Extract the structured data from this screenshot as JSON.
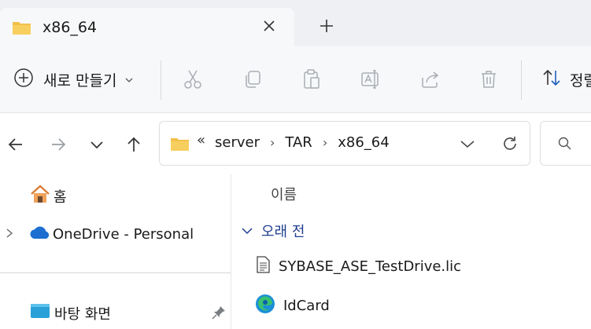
{
  "tab": {
    "title": "x86_64",
    "folder_icon": "folder-icon",
    "close_icon": "close-icon"
  },
  "tabstrip": {
    "new_tab_icon": "plus-icon"
  },
  "toolbar": {
    "new_label": "새로 만들기",
    "sort_label": "정렬",
    "icons": [
      "cut-icon",
      "copy-icon",
      "paste-icon",
      "rename-icon",
      "share-icon",
      "delete-icon"
    ]
  },
  "nav": {
    "back_icon": "back-arrow-icon",
    "forward_icon": "forward-arrow-icon",
    "recent_icon": "chevron-down-icon",
    "up_icon": "up-arrow-icon"
  },
  "address": {
    "overflow": "«",
    "crumbs": [
      "server",
      "TAR",
      "x86_64"
    ]
  },
  "sidebar": {
    "home_label": "홈",
    "onedrive_label": "OneDrive - Personal",
    "desktop_label": "바탕 화면"
  },
  "main": {
    "column_name": "이름",
    "group_label": "오래 전",
    "files": [
      {
        "name": "SYBASE_ASE_TestDrive.lic",
        "icon": "text-file-icon"
      },
      {
        "name": "IdCard",
        "icon": "edge-icon"
      }
    ]
  },
  "colors": {
    "accent": "#1f3f8f",
    "folder": "#f2c04a",
    "background": "#f7f8fa"
  }
}
